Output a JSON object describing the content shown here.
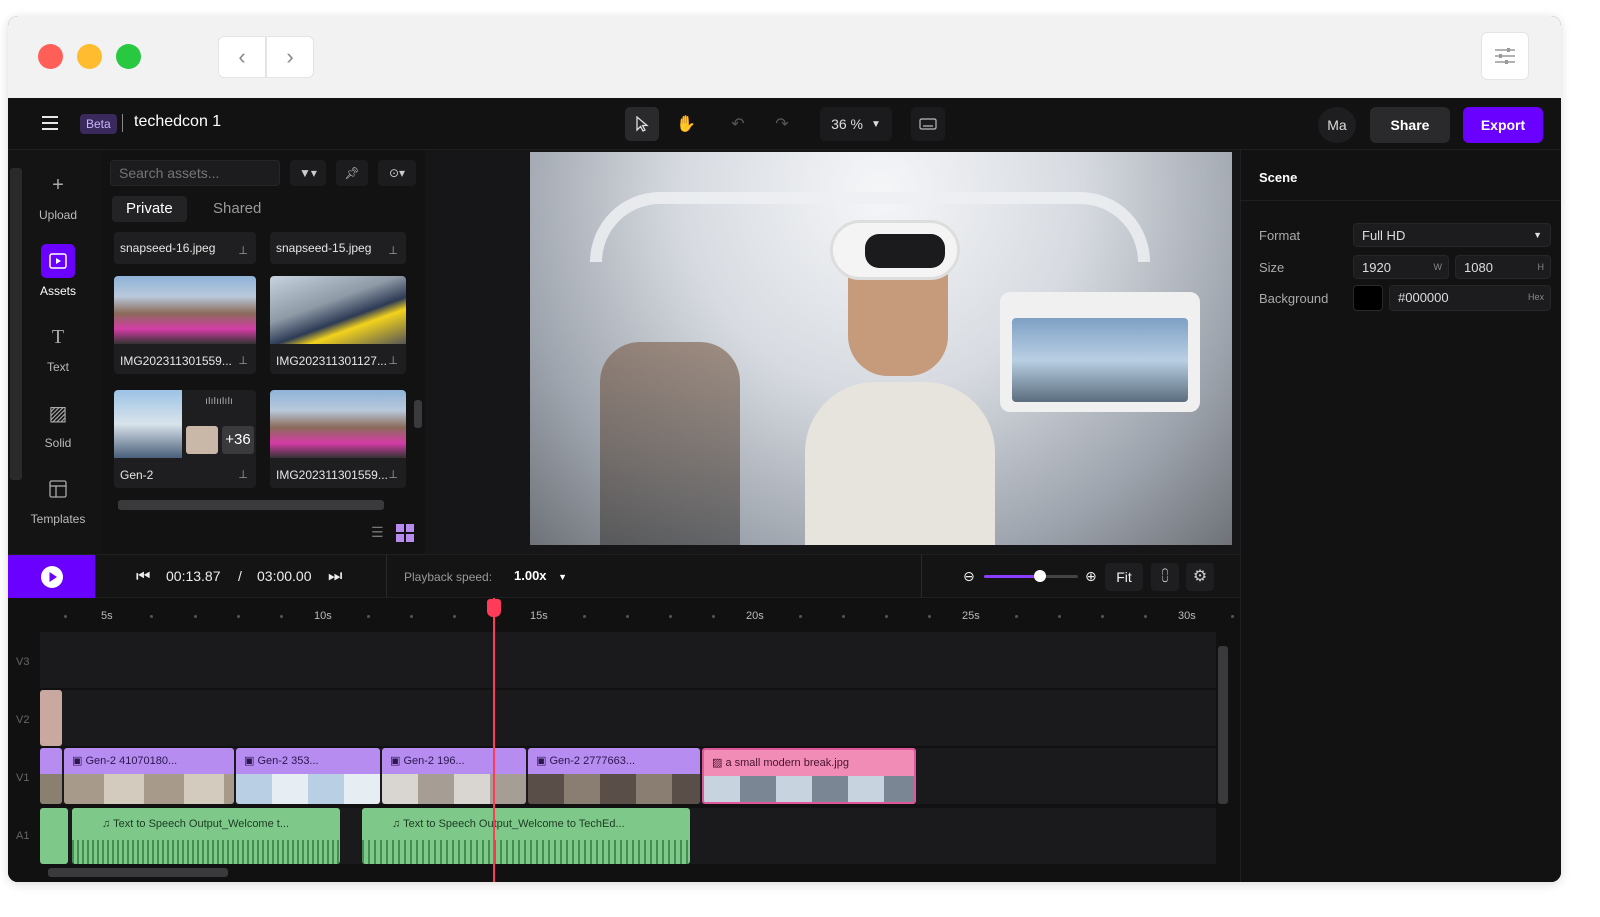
{
  "window": {
    "traffic_lights": [
      "#ff5f57",
      "#febc2e",
      "#28c840"
    ]
  },
  "topbar": {
    "badge": "Beta",
    "project_name": "techedcon 1",
    "zoom": "36 %",
    "user_initials": "Ma",
    "share_label": "Share",
    "export_label": "Export"
  },
  "rail": {
    "items": [
      {
        "label": "Upload",
        "icon": "plus-icon"
      },
      {
        "label": "Assets",
        "icon": "folder-play-icon"
      },
      {
        "label": "Text",
        "icon": "text-t-icon"
      },
      {
        "label": "Solid",
        "icon": "hatch-icon"
      },
      {
        "label": "Templates",
        "icon": "layout-icon"
      }
    ]
  },
  "assets": {
    "search_placeholder": "Search assets...",
    "tabs": [
      "Private",
      "Shared"
    ],
    "row1": [
      "snapseed-16.jpeg",
      "snapseed-15.jpeg"
    ],
    "row2": [
      "IMG202311301559...",
      "IMG202311301127..."
    ],
    "row3": [
      "Gen-2",
      "IMG202311301559..."
    ],
    "more_count": "+36"
  },
  "scene": {
    "title": "Scene",
    "format_label": "Format",
    "format_value": "Full HD",
    "size_label": "Size",
    "width": "1920",
    "width_unit": "W",
    "height": "1080",
    "height_unit": "H",
    "background_label": "Background",
    "background_hex": "#000000",
    "hex_unit": "Hex"
  },
  "transport": {
    "current_time": "00:13.87",
    "time_sep": "/",
    "total_time": "03:00.00",
    "speed_label": "Playback speed:",
    "speed_value": "1.00x",
    "fit_label": "Fit",
    "zoom_slider_fraction": 0.6
  },
  "ruler": {
    "labels": [
      "5s",
      "10s",
      "15s",
      "20s",
      "25s",
      "30s"
    ]
  },
  "tracks": {
    "labels": [
      "V3",
      "V2",
      "V1",
      "A1"
    ],
    "video_clips": [
      "Gen-2 41070180...",
      "Gen-2 353...",
      "Gen-2 196...",
      "Gen-2 2777663...",
      "a small modern break.jpg"
    ],
    "audio_clips": [
      "Text to Speech Output_Welcome t...",
      "Text to Speech Output_Welcome to TechEd..."
    ]
  },
  "colors": {
    "accent": "#6a00ff",
    "playhead": "#ff3b5a",
    "video_clip": "#b68cf0",
    "image_clip": "#f08cb6",
    "audio_clip": "#7ec98a"
  }
}
